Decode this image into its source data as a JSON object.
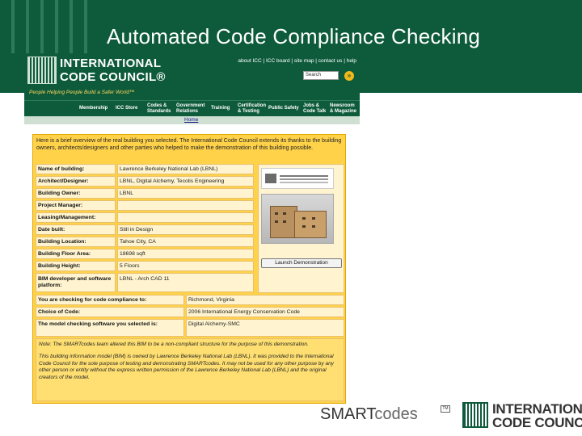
{
  "slide": {
    "title": "Automated Code Compliance Checking"
  },
  "web": {
    "logo_line1": "INTERNATIONAL",
    "logo_line2": "CODE COUNCIL®",
    "tagline": "People Helping People Build a Safer World™",
    "top_links": "about ICC  |  ICC board  |  site map  |  contact us  |  help",
    "search_value": "Search",
    "nav": [
      {
        "line1": "Membership",
        "line2": ""
      },
      {
        "line1": "ICC Store",
        "line2": ""
      },
      {
        "line1": "Codes &",
        "line2": "Standards"
      },
      {
        "line1": "Government",
        "line2": "Relations"
      },
      {
        "line1": "Training",
        "line2": ""
      },
      {
        "line1": "Certification",
        "line2": "& Testing"
      },
      {
        "line1": "Public Safety",
        "line2": ""
      },
      {
        "line1": "Jobs &",
        "line2": "Code Talk"
      },
      {
        "line1": "Newsroom",
        "line2": "& Magazine"
      }
    ],
    "breadcrumb_home": "Home"
  },
  "panel": {
    "intro": "Here is a brief overview of the real building you selected. The International Code Council extends its thanks to the building owners, architects/designers and other parties who helped to make the demonstration of this building possible.",
    "rows": [
      {
        "label": "Name of building:",
        "value": "Lawrence Berkeley National Lab (LBNL)"
      },
      {
        "label": "Architect/Designer:",
        "value": "LBNL, Digital Alchemy, Tecolis Engineering"
      },
      {
        "label": "Building Owner:",
        "value": "LBNL"
      },
      {
        "label": "Project Manager:",
        "value": ""
      },
      {
        "label": "Leasing/Management:",
        "value": ""
      },
      {
        "label": "Date built:",
        "value": "Still in Design"
      },
      {
        "label": "Building Location:",
        "value": "Tahoe City, CA"
      },
      {
        "label": "Building Floor Area:",
        "value": "18698 sqft"
      },
      {
        "label": "Building Height:",
        "value": "5 Floors"
      },
      {
        "label": "BIM developer and software platform:",
        "value": "LBNL - Arch CAD 11"
      }
    ],
    "launch_button": "Launch Demonstration",
    "code_rows": [
      {
        "label": "You are checking for code compliance to:",
        "value": "Richmond, Virginia"
      },
      {
        "label": "Choice of Code:",
        "value": "2006 International Energy Conservation Code"
      },
      {
        "label": "The model checking software you selected is:",
        "value": "Digital Alchemy-SMC"
      }
    ],
    "note1": "Note: The SMARTcodes team altered this BIM to be a non-compliant structure for the purpose of this demonstration.",
    "note2": "This building information model (BIM) is owned by Lawrence Berkeley National Lab (LBNL). It was provided to the International Code Council for the sole purpose of testing and demonstrating SMARTcodes. It may not be used for any other purpose by any other person or entity without the express written permission of the Lawrence Berkeley National Lab (LBNL) and the original creators of the model."
  },
  "footer": {
    "smart_part": "SMART",
    "codes_part": "codes",
    "tm": "TM",
    "icc_line1": "INTERNATIONAL",
    "icc_line2": "CODE COUNCIL®"
  },
  "colors": {
    "brand_green": "#0e5b3c",
    "panel_yellow": "#ffd24a",
    "accent_gold": "#f2b81b"
  }
}
